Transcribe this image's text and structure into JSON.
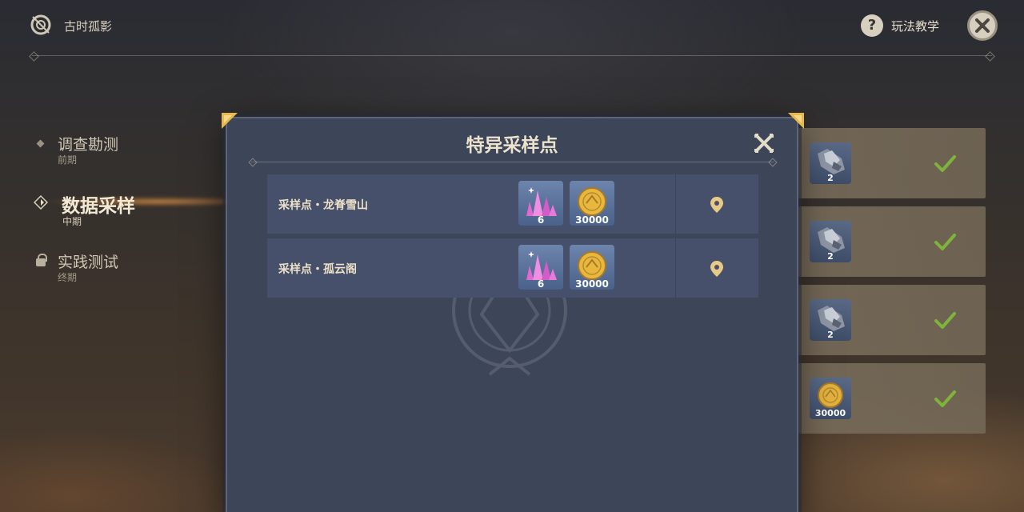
{
  "topbar": {
    "title": "古时孤影",
    "help_label": "玩法教学"
  },
  "nav": {
    "items": [
      {
        "label": "调查勘测",
        "sub": "前期"
      },
      {
        "label": "数据采样",
        "sub": "中期"
      },
      {
        "label": "实践测试",
        "sub": "终期"
      }
    ]
  },
  "rewards": [
    {
      "qty": "2"
    },
    {
      "qty": "2"
    },
    {
      "qty": "2"
    },
    {
      "qty": "30000"
    }
  ],
  "modal": {
    "title": "特异采样点",
    "sites": [
      {
        "name": "采样点・龙脊雪山",
        "crystal_qty": "6",
        "mora_qty": "30000"
      },
      {
        "name": "采样点・孤云阁",
        "crystal_qty": "6",
        "mora_qty": "30000"
      }
    ]
  },
  "colors": {
    "accent_gold": "#e6b94a",
    "check_green": "#7fb33a",
    "modal_bg": "#3d4559"
  }
}
